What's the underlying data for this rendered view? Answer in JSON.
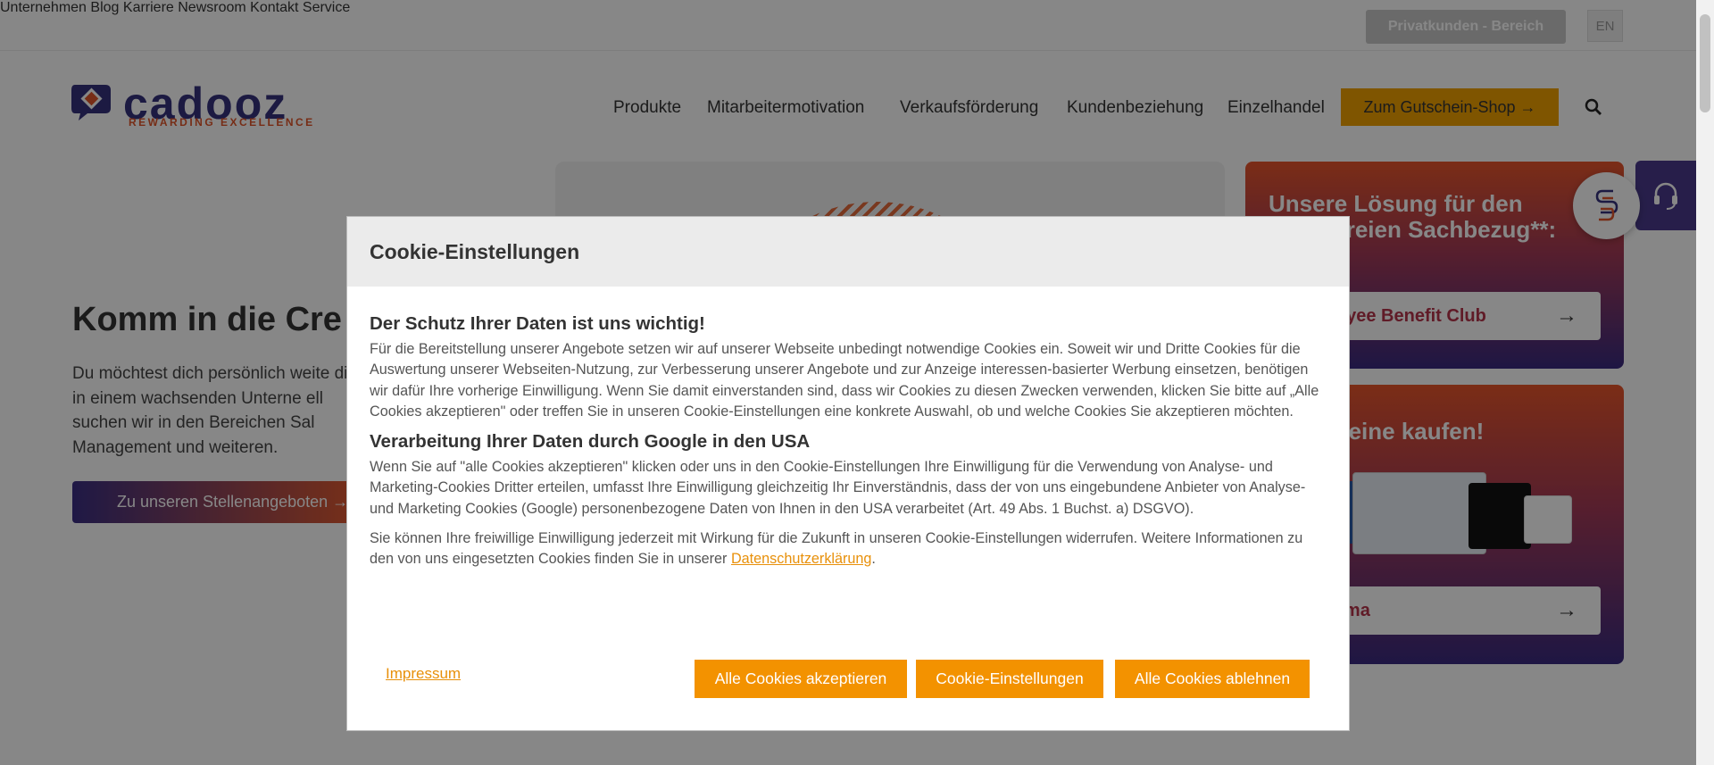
{
  "topbar": {
    "links": [
      "Unternehmen",
      "Blog",
      "Karriere",
      "Newsroom",
      "Kontakt",
      "Service"
    ],
    "privat_label": "Privatkunden - Bereich",
    "lang_label": "EN"
  },
  "logo": {
    "wordmark": "cadooz",
    "tagline": "REWARDING EXCELLENCE"
  },
  "mainnav": {
    "links": [
      "Produkte",
      "Mitarbeitermotivation",
      "Verkaufsförderung",
      "Kundenbeziehung",
      "Einzelhandel"
    ],
    "shop_label": "Zum Gutschein-Shop →"
  },
  "hero": {
    "title": "Komm in die Cre",
    "text": "Du möchtest dich persönlich weite dich in einem wachsenden Unterne ell suchen wir in den Bereichen Sal Management und weiteren.",
    "button_label": "Zu unseren Stellenangeboten →"
  },
  "cards": [
    {
      "title": "Unsere Lösung für den steuerfreien Sachbezug**:",
      "button_label": "Employee Benefit Club",
      "arrow": "→"
    },
    {
      "title": "Gutscheine kaufen!",
      "button_label": "als Firma",
      "arrow": "→"
    }
  ],
  "modal": {
    "title": "Cookie-Einstellungen",
    "heading1": "Der Schutz Ihrer Daten ist uns wichtig!",
    "para1": "Für die Bereitstellung unserer Angebote setzen wir auf unserer Webseite unbedingt notwendige Cookies ein. Soweit wir und Dritte Cookies für die Auswertung unserer Webseiten-Nutzung, zur Verbesserung unserer Angebote und zur Anzeige interessen-basierter Werbung einsetzen, benötigen wir dafür Ihre vorherige Einwilligung. Wenn Sie damit einverstanden sind, dass wir Cookies zu diesen Zwecken verwenden, klicken Sie bitte auf „Alle Cookies akzeptieren\" oder treffen Sie in unseren Cookie-Einstellungen eine konkrete Auswahl, ob und welche Cookies Sie akzeptieren möchten.",
    "heading2": "Verarbeitung Ihrer Daten durch Google in den USA",
    "para2": "Wenn Sie auf \"alle Cookies akzeptieren\" klicken oder uns in den Cookie-Einstellungen Ihre Einwilligung für die Verwendung von Analyse- und Marketing-Cookies Dritter erteilen, umfasst Ihre Einwilligung gleichzeitig Ihr Einverständnis, dass der von uns eingebundene Anbieter von Analyse- und Marketing Cookies (Google) personenbezogene Daten von Ihnen in den USA verarbeitet (Art. 49 Abs. 1 Buchst. a) DSGVO).",
    "para3": "Sie können Ihre freiwillige Einwilligung jederzeit mit Wirkung für die Zukunft in unseren Cookie-Einstellungen widerrufen. Weitere Informationen zu den von uns eingesetzten Cookies finden Sie in unserer",
    "privacy_link": "Datenschutzerklärung",
    "period": ".",
    "impressum": "Impressum",
    "accept_all": "Alle Cookies akzeptieren",
    "settings": "Cookie-Einstellungen",
    "reject_all": "Alle Cookies ablehnen"
  },
  "colors": {
    "accent_orange": "#f39200",
    "brand_purple": "#35317d",
    "brand_red": "#e0552a"
  }
}
